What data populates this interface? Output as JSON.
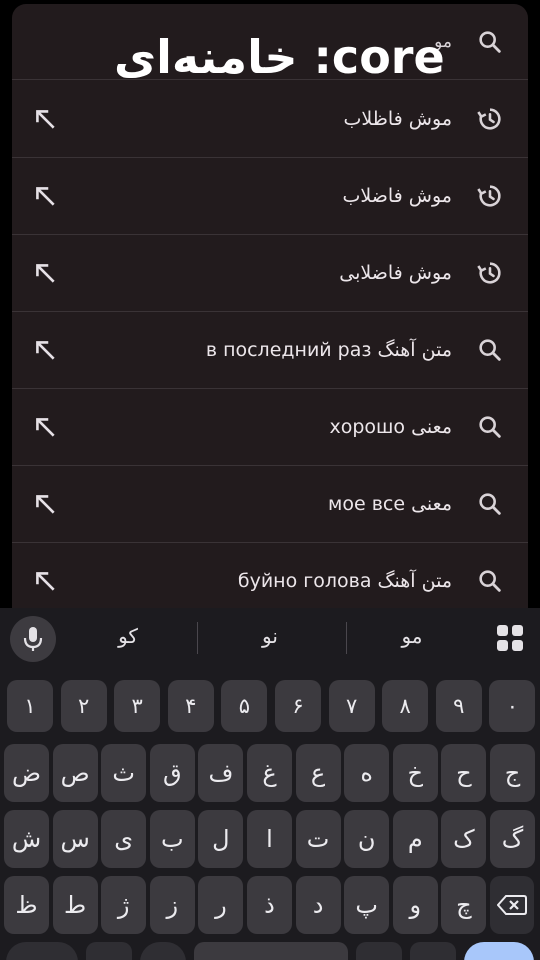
{
  "search": {
    "query": "مو",
    "overlay": "خامنه‌ای :core"
  },
  "suggestions": [
    {
      "type": "history",
      "text": "موش فاظلاب"
    },
    {
      "type": "history",
      "text": "موش فاضلاب"
    },
    {
      "type": "history",
      "text": "موش فاضلابی"
    },
    {
      "type": "search",
      "text": "متن آهنگ в последний раз"
    },
    {
      "type": "search",
      "text": "معنی хорошо"
    },
    {
      "type": "search",
      "text": "معنی мое все"
    },
    {
      "type": "search",
      "text": "متن آهنگ буйно голова"
    }
  ],
  "keyboard": {
    "word_suggestions": [
      "کو",
      "نو",
      "مو"
    ],
    "rows": [
      [
        "۱",
        "۲",
        "۳",
        "۴",
        "۵",
        "۶",
        "۷",
        "۸",
        "۹",
        "۰"
      ],
      [
        "ض",
        "ص",
        "ث",
        "ق",
        "ف",
        "غ",
        "ع",
        "ه",
        "خ",
        "ح",
        "ج"
      ],
      [
        "ش",
        "س",
        "ی",
        "ب",
        "ل",
        "ا",
        "ت",
        "ن",
        "م",
        "ک",
        "گ"
      ],
      [
        "ظ",
        "ط",
        "ژ",
        "ز",
        "ر",
        "ذ",
        "د",
        "پ",
        "و",
        "چ"
      ]
    ]
  },
  "colors": {
    "panel": "#221b1d",
    "keyboard": "#1c1b1f",
    "key": "#3c3a3f",
    "accent": "#a8c7fa"
  }
}
